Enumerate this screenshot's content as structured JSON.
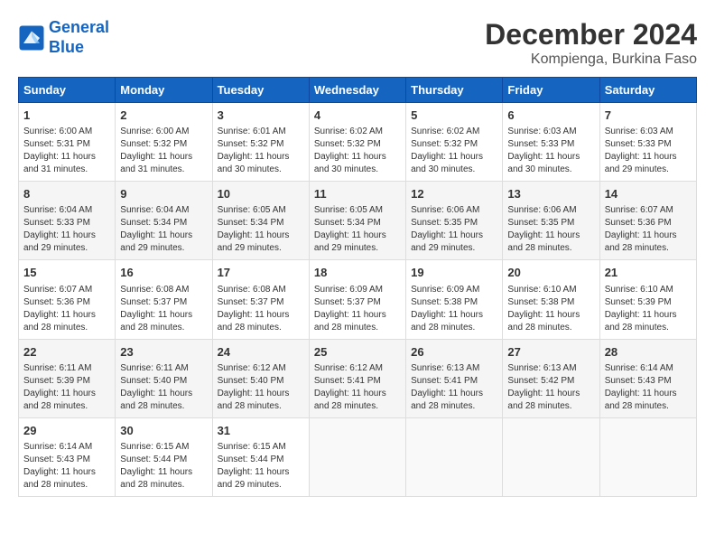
{
  "header": {
    "logo_line1": "General",
    "logo_line2": "Blue",
    "month": "December 2024",
    "location": "Kompienga, Burkina Faso"
  },
  "days_of_week": [
    "Sunday",
    "Monday",
    "Tuesday",
    "Wednesday",
    "Thursday",
    "Friday",
    "Saturday"
  ],
  "weeks": [
    [
      {
        "day": "1",
        "info": "Sunrise: 6:00 AM\nSunset: 5:31 PM\nDaylight: 11 hours\nand 31 minutes."
      },
      {
        "day": "2",
        "info": "Sunrise: 6:00 AM\nSunset: 5:32 PM\nDaylight: 11 hours\nand 31 minutes."
      },
      {
        "day": "3",
        "info": "Sunrise: 6:01 AM\nSunset: 5:32 PM\nDaylight: 11 hours\nand 30 minutes."
      },
      {
        "day": "4",
        "info": "Sunrise: 6:02 AM\nSunset: 5:32 PM\nDaylight: 11 hours\nand 30 minutes."
      },
      {
        "day": "5",
        "info": "Sunrise: 6:02 AM\nSunset: 5:32 PM\nDaylight: 11 hours\nand 30 minutes."
      },
      {
        "day": "6",
        "info": "Sunrise: 6:03 AM\nSunset: 5:33 PM\nDaylight: 11 hours\nand 30 minutes."
      },
      {
        "day": "7",
        "info": "Sunrise: 6:03 AM\nSunset: 5:33 PM\nDaylight: 11 hours\nand 29 minutes."
      }
    ],
    [
      {
        "day": "8",
        "info": "Sunrise: 6:04 AM\nSunset: 5:33 PM\nDaylight: 11 hours\nand 29 minutes."
      },
      {
        "day": "9",
        "info": "Sunrise: 6:04 AM\nSunset: 5:34 PM\nDaylight: 11 hours\nand 29 minutes."
      },
      {
        "day": "10",
        "info": "Sunrise: 6:05 AM\nSunset: 5:34 PM\nDaylight: 11 hours\nand 29 minutes."
      },
      {
        "day": "11",
        "info": "Sunrise: 6:05 AM\nSunset: 5:34 PM\nDaylight: 11 hours\nand 29 minutes."
      },
      {
        "day": "12",
        "info": "Sunrise: 6:06 AM\nSunset: 5:35 PM\nDaylight: 11 hours\nand 29 minutes."
      },
      {
        "day": "13",
        "info": "Sunrise: 6:06 AM\nSunset: 5:35 PM\nDaylight: 11 hours\nand 28 minutes."
      },
      {
        "day": "14",
        "info": "Sunrise: 6:07 AM\nSunset: 5:36 PM\nDaylight: 11 hours\nand 28 minutes."
      }
    ],
    [
      {
        "day": "15",
        "info": "Sunrise: 6:07 AM\nSunset: 5:36 PM\nDaylight: 11 hours\nand 28 minutes."
      },
      {
        "day": "16",
        "info": "Sunrise: 6:08 AM\nSunset: 5:37 PM\nDaylight: 11 hours\nand 28 minutes."
      },
      {
        "day": "17",
        "info": "Sunrise: 6:08 AM\nSunset: 5:37 PM\nDaylight: 11 hours\nand 28 minutes."
      },
      {
        "day": "18",
        "info": "Sunrise: 6:09 AM\nSunset: 5:37 PM\nDaylight: 11 hours\nand 28 minutes."
      },
      {
        "day": "19",
        "info": "Sunrise: 6:09 AM\nSunset: 5:38 PM\nDaylight: 11 hours\nand 28 minutes."
      },
      {
        "day": "20",
        "info": "Sunrise: 6:10 AM\nSunset: 5:38 PM\nDaylight: 11 hours\nand 28 minutes."
      },
      {
        "day": "21",
        "info": "Sunrise: 6:10 AM\nSunset: 5:39 PM\nDaylight: 11 hours\nand 28 minutes."
      }
    ],
    [
      {
        "day": "22",
        "info": "Sunrise: 6:11 AM\nSunset: 5:39 PM\nDaylight: 11 hours\nand 28 minutes."
      },
      {
        "day": "23",
        "info": "Sunrise: 6:11 AM\nSunset: 5:40 PM\nDaylight: 11 hours\nand 28 minutes."
      },
      {
        "day": "24",
        "info": "Sunrise: 6:12 AM\nSunset: 5:40 PM\nDaylight: 11 hours\nand 28 minutes."
      },
      {
        "day": "25",
        "info": "Sunrise: 6:12 AM\nSunset: 5:41 PM\nDaylight: 11 hours\nand 28 minutes."
      },
      {
        "day": "26",
        "info": "Sunrise: 6:13 AM\nSunset: 5:41 PM\nDaylight: 11 hours\nand 28 minutes."
      },
      {
        "day": "27",
        "info": "Sunrise: 6:13 AM\nSunset: 5:42 PM\nDaylight: 11 hours\nand 28 minutes."
      },
      {
        "day": "28",
        "info": "Sunrise: 6:14 AM\nSunset: 5:43 PM\nDaylight: 11 hours\nand 28 minutes."
      }
    ],
    [
      {
        "day": "29",
        "info": "Sunrise: 6:14 AM\nSunset: 5:43 PM\nDaylight: 11 hours\nand 28 minutes."
      },
      {
        "day": "30",
        "info": "Sunrise: 6:15 AM\nSunset: 5:44 PM\nDaylight: 11 hours\nand 28 minutes."
      },
      {
        "day": "31",
        "info": "Sunrise: 6:15 AM\nSunset: 5:44 PM\nDaylight: 11 hours\nand 29 minutes."
      },
      {
        "day": "",
        "info": ""
      },
      {
        "day": "",
        "info": ""
      },
      {
        "day": "",
        "info": ""
      },
      {
        "day": "",
        "info": ""
      }
    ]
  ]
}
